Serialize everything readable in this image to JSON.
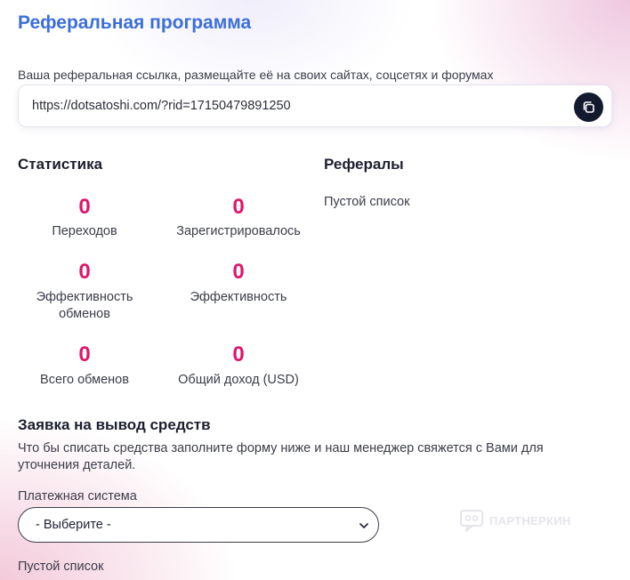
{
  "header": {
    "title": "Реферальная программа"
  },
  "referral": {
    "caption": "Ваша реферальная ссылка, размещайте её на своих сайтах, соцсетях и форумах",
    "link": "https://dotsatoshi.com/?rid=17150479891250",
    "copy_icon": "copy-icon"
  },
  "stats": {
    "title": "Статистика",
    "items": [
      {
        "value": "0",
        "label": "Переходов"
      },
      {
        "value": "0",
        "label": "Зарегистрировалось"
      },
      {
        "value": "0",
        "label_line1": "Эффективность",
        "label_line2": "обменов"
      },
      {
        "value": "0",
        "label": "Эффективность"
      },
      {
        "value": "0",
        "label": "Всего обменов"
      },
      {
        "value": "0",
        "label": "Общий доход (USD)"
      }
    ]
  },
  "referrals": {
    "title": "Рефералы",
    "empty": "Пустой список"
  },
  "withdrawal": {
    "title": "Заявка на вывод средств",
    "description": "Что бы списать средства заполните форму ниже и наш менеджер свяжется с Вами для уточнения деталей.",
    "payment_label": "Платежная система",
    "payment_selected": "- Выберите -",
    "empty": "Пустой список"
  },
  "watermark": {
    "text": "ПАРТНЕРКИН"
  },
  "colors": {
    "accent_blue": "#3b6fd8",
    "stat_pink": "#e0156c",
    "dark": "#141a2e"
  }
}
